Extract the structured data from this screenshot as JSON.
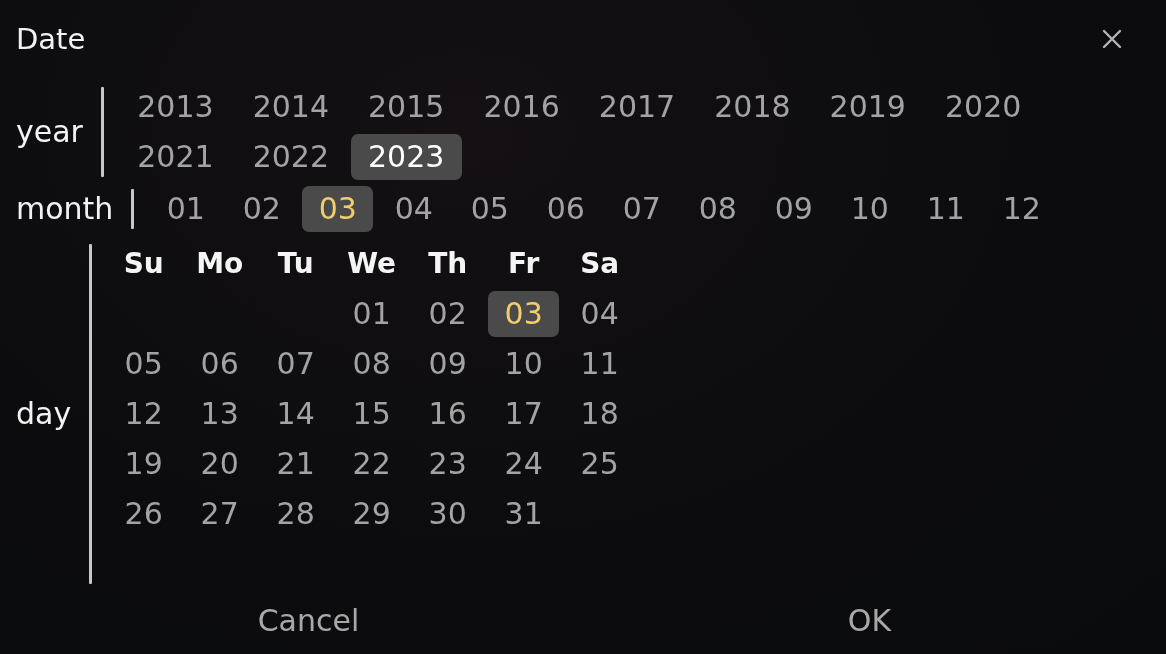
{
  "dialog": {
    "title": "Date"
  },
  "year": {
    "label": "year",
    "options": [
      {
        "label": "2013",
        "selected": false
      },
      {
        "label": "2014",
        "selected": false
      },
      {
        "label": "2015",
        "selected": false
      },
      {
        "label": "2016",
        "selected": false
      },
      {
        "label": "2017",
        "selected": false
      },
      {
        "label": "2018",
        "selected": false
      },
      {
        "label": "2019",
        "selected": false
      },
      {
        "label": "2020",
        "selected": false
      },
      {
        "label": "2021",
        "selected": false
      },
      {
        "label": "2022",
        "selected": false
      },
      {
        "label": "2023",
        "selected": true
      }
    ]
  },
  "month": {
    "label": "month",
    "options": [
      {
        "label": "01",
        "selected": false
      },
      {
        "label": "02",
        "selected": false
      },
      {
        "label": "03",
        "selected": true
      },
      {
        "label": "04",
        "selected": false
      },
      {
        "label": "05",
        "selected": false
      },
      {
        "label": "06",
        "selected": false
      },
      {
        "label": "07",
        "selected": false
      },
      {
        "label": "08",
        "selected": false
      },
      {
        "label": "09",
        "selected": false
      },
      {
        "label": "10",
        "selected": false
      },
      {
        "label": "11",
        "selected": false
      },
      {
        "label": "12",
        "selected": false
      }
    ]
  },
  "day": {
    "label": "day",
    "weekdays": [
      "Su",
      "Mo",
      "Tu",
      "We",
      "Th",
      "Fr",
      "Sa"
    ],
    "weeks": [
      [
        {
          "label": "01",
          "selected": false
        },
        {
          "label": "02",
          "selected": false
        },
        {
          "label": "03",
          "selected": true
        },
        {
          "label": "04",
          "selected": false
        }
      ],
      [
        {
          "label": "05",
          "selected": false
        },
        {
          "label": "06",
          "selected": false
        },
        {
          "label": "07",
          "selected": false
        },
        {
          "label": "08",
          "selected": false
        },
        {
          "label": "09",
          "selected": false
        },
        {
          "label": "10",
          "selected": false
        },
        {
          "label": "11",
          "selected": false
        }
      ],
      [
        {
          "label": "12",
          "selected": false
        },
        {
          "label": "13",
          "selected": false
        },
        {
          "label": "14",
          "selected": false
        },
        {
          "label": "15",
          "selected": false
        },
        {
          "label": "16",
          "selected": false
        },
        {
          "label": "17",
          "selected": false
        },
        {
          "label": "18",
          "selected": false
        }
      ],
      [
        {
          "label": "19",
          "selected": false
        },
        {
          "label": "20",
          "selected": false
        },
        {
          "label": "21",
          "selected": false
        },
        {
          "label": "22",
          "selected": false
        },
        {
          "label": "23",
          "selected": false
        },
        {
          "label": "24",
          "selected": false
        },
        {
          "label": "25",
          "selected": false
        }
      ],
      [
        {
          "label": "26",
          "selected": false
        },
        {
          "label": "27",
          "selected": false
        },
        {
          "label": "28",
          "selected": false
        },
        {
          "label": "29",
          "selected": false
        },
        {
          "label": "30",
          "selected": false
        },
        {
          "label": "31",
          "selected": false
        }
      ]
    ]
  },
  "buttons": [
    "Cancel",
    "OK"
  ]
}
